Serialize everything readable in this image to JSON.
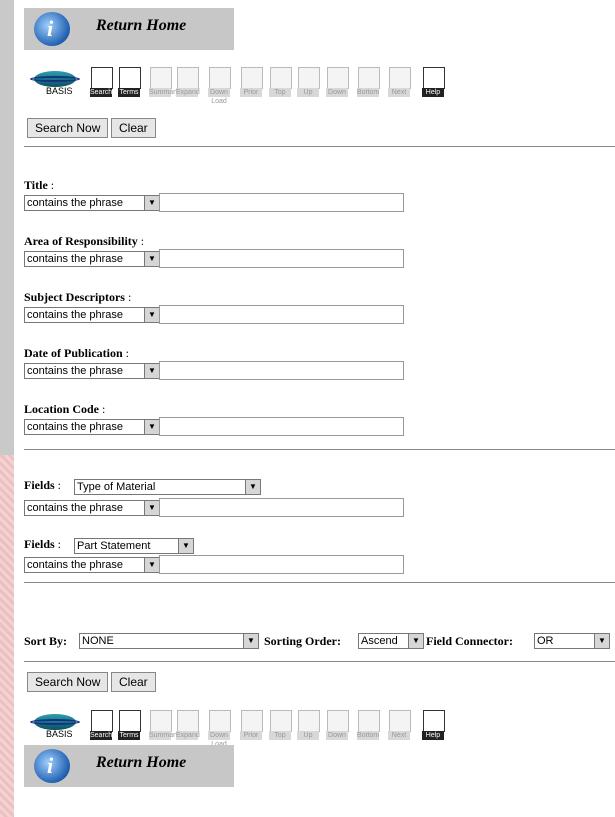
{
  "nav": {
    "return_home": "Return Home"
  },
  "toolbar": {
    "basis": "BASIS",
    "buttons": [
      {
        "label": "Search",
        "icon": "search-icon",
        "active": true
      },
      {
        "label": "Terms",
        "icon": "terms-icon",
        "active": true
      },
      {
        "label": "Summary",
        "icon": "summary-icon",
        "active": false
      },
      {
        "label": "Expand",
        "icon": "expand-icon",
        "active": false
      },
      {
        "label": "Down Load",
        "icon": "download-icon",
        "active": false
      },
      {
        "label": "Prior",
        "icon": "prior-icon",
        "active": false
      },
      {
        "label": "Top",
        "icon": "top-icon",
        "active": false
      },
      {
        "label": "Up",
        "icon": "up-icon",
        "active": false
      },
      {
        "label": "Down",
        "icon": "down-icon",
        "active": false
      },
      {
        "label": "Bottom",
        "icon": "bottom-icon",
        "active": false
      },
      {
        "label": "Next",
        "icon": "next-icon",
        "active": false
      },
      {
        "label": "Help",
        "icon": "help-icon",
        "active": true
      }
    ]
  },
  "actions": {
    "search": "Search Now",
    "clear": "Clear"
  },
  "fields": [
    {
      "label": "Title",
      "operator": "contains the phrase",
      "value": ""
    },
    {
      "label": "Area of Responsibility",
      "operator": "contains the phrase",
      "value": ""
    },
    {
      "label": "Subject Descriptors",
      "operator": "contains the phrase",
      "value": ""
    },
    {
      "label": "Date of Publication",
      "operator": "contains the phrase",
      "value": ""
    },
    {
      "label": "Location Code",
      "operator": "contains the phrase",
      "value": ""
    }
  ],
  "custom_fields": [
    {
      "label": "Fields",
      "field": "Type of Material",
      "operator": "contains the phrase",
      "value": ""
    },
    {
      "label": "Fields",
      "field": "Part Statement",
      "operator": "contains the phrase",
      "value": ""
    }
  ],
  "sort": {
    "sort_by_label": "Sort By:",
    "sort_by_value": "NONE",
    "order_label": "Sorting Order:",
    "order_value": "Ascend",
    "connector_label": "Field Connector:",
    "connector_value": "OR"
  },
  "colon": ":"
}
